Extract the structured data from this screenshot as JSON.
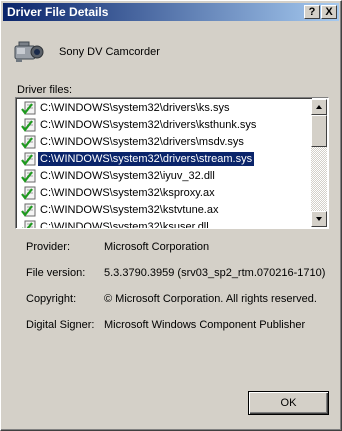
{
  "window": {
    "title": "Driver File Details",
    "help_glyph": "?",
    "close_glyph": "X"
  },
  "device": {
    "name": "Sony DV Camcorder",
    "icon": "camcorder-icon"
  },
  "driver_files": {
    "label": "Driver files:",
    "items": [
      {
        "path": "C:\\WINDOWS\\system32\\drivers\\ks.sys",
        "icon": "signed-check-icon",
        "selected": false
      },
      {
        "path": "C:\\WINDOWS\\system32\\drivers\\ksthunk.sys",
        "icon": "signed-check-icon",
        "selected": false
      },
      {
        "path": "C:\\WINDOWS\\system32\\drivers\\msdv.sys",
        "icon": "signed-check-icon",
        "selected": false
      },
      {
        "path": "C:\\WINDOWS\\system32\\drivers\\stream.sys",
        "icon": "signed-check-icon",
        "selected": true
      },
      {
        "path": "C:\\WINDOWS\\system32\\iyuv_32.dll",
        "icon": "signed-check-icon",
        "selected": false
      },
      {
        "path": "C:\\WINDOWS\\system32\\ksproxy.ax",
        "icon": "signed-check-icon",
        "selected": false
      },
      {
        "path": "C:\\WINDOWS\\system32\\kstvtune.ax",
        "icon": "signed-check-icon",
        "selected": false
      },
      {
        "path": "C:\\WINDOWS\\system32\\ksuser.dll",
        "icon": "signed-check-icon",
        "selected": false
      }
    ]
  },
  "details": {
    "provider_label": "Provider:",
    "provider_value": "Microsoft Corporation",
    "version_label": "File version:",
    "version_value": "5.3.3790.3959 (srv03_sp2_rtm.070216-1710)",
    "copyright_label": "Copyright:",
    "copyright_value": "© Microsoft Corporation. All rights reserved.",
    "signer_label": "Digital Signer:",
    "signer_value": "Microsoft Windows Component Publisher"
  },
  "buttons": {
    "ok_label": "OK"
  },
  "colors": {
    "titlebar_start": "#0a246a",
    "titlebar_end": "#a6caf0",
    "selection": "#0a246a",
    "dialog_face": "#d4d0c8"
  }
}
